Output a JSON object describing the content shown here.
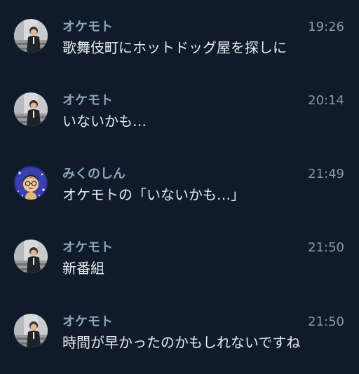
{
  "messages": [
    {
      "avatar": "person-photo-avatar",
      "name": "オケモト",
      "time": "19:26",
      "text": "歌舞伎町にホットドッグ屋を探しに"
    },
    {
      "avatar": "person-photo-avatar",
      "name": "オケモト",
      "time": "20:14",
      "text": "いないかも…"
    },
    {
      "avatar": "illustrated-face-avatar",
      "name": "みくのしん",
      "time": "21:49",
      "text": "オケモトの「いないかも…」"
    },
    {
      "avatar": "person-photo-avatar",
      "name": "オケモト",
      "time": "21:50",
      "text": "新番組"
    },
    {
      "avatar": "person-photo-avatar",
      "name": "オケモト",
      "time": "21:50",
      "text": "時間が早かったのかもしれないですね"
    }
  ]
}
